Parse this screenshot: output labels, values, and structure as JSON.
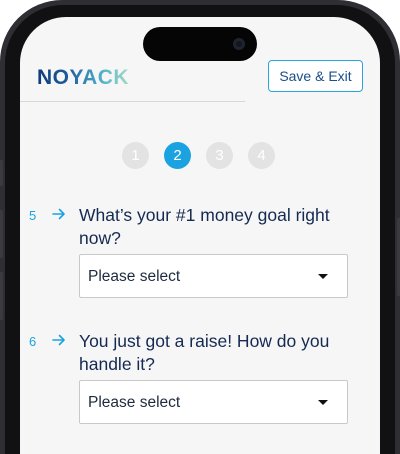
{
  "header": {
    "logo_text": "NOYACK",
    "save_exit_label": "Save & Exit"
  },
  "steps": [
    "1",
    "2",
    "3",
    "4"
  ],
  "active_step": 2,
  "questions": [
    {
      "number": "5",
      "text": "What’s your #1 money goal right now?",
      "select_value": "Please select"
    },
    {
      "number": "6",
      "text": "You just got a raise! How do you handle it?",
      "select_value": "Please select"
    }
  ],
  "icons": {
    "arrow": "arrow-right-icon",
    "caret": "caret-down-icon",
    "camera": "camera-icon"
  },
  "colors": {
    "accent": "#1aa3e0",
    "brand_dark": "#0f3b78",
    "text_dark": "#152a52"
  }
}
